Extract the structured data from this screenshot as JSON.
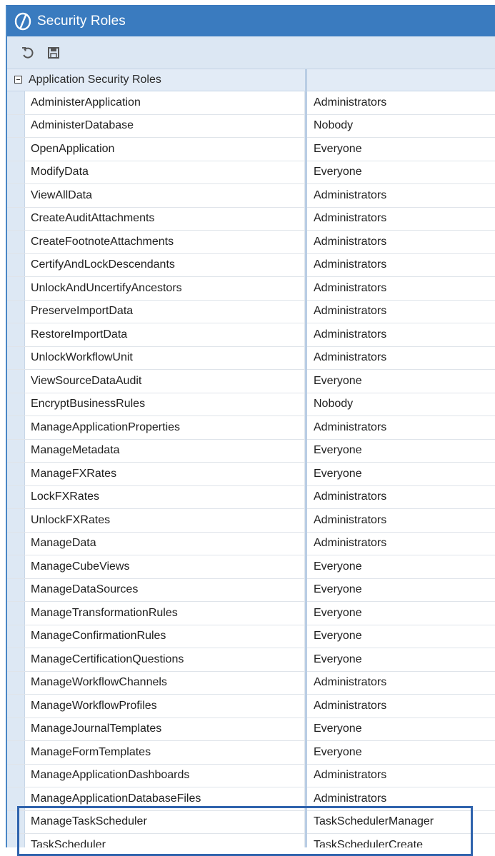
{
  "window": {
    "title": "Security Roles",
    "logo_icon": "onestream-logo-icon"
  },
  "toolbar": {
    "buttons": [
      {
        "icon": "refresh-icon",
        "tooltip": ""
      },
      {
        "icon": "save-icon",
        "tooltip": ""
      }
    ]
  },
  "group": {
    "label": "Application Security Roles",
    "expanded": true
  },
  "roles": [
    {
      "name": "AdministerApplication",
      "value": "Administrators"
    },
    {
      "name": "AdministerDatabase",
      "value": "Nobody"
    },
    {
      "name": "OpenApplication",
      "value": "Everyone"
    },
    {
      "name": "ModifyData",
      "value": "Everyone"
    },
    {
      "name": "ViewAllData",
      "value": "Administrators"
    },
    {
      "name": "CreateAuditAttachments",
      "value": "Administrators"
    },
    {
      "name": "CreateFootnoteAttachments",
      "value": "Administrators"
    },
    {
      "name": "CertifyAndLockDescendants",
      "value": "Administrators"
    },
    {
      "name": "UnlockAndUncertifyAncestors",
      "value": "Administrators"
    },
    {
      "name": "PreserveImportData",
      "value": "Administrators"
    },
    {
      "name": "RestoreImportData",
      "value": "Administrators"
    },
    {
      "name": "UnlockWorkflowUnit",
      "value": "Administrators"
    },
    {
      "name": "ViewSourceDataAudit",
      "value": "Everyone"
    },
    {
      "name": "EncryptBusinessRules",
      "value": "Nobody"
    },
    {
      "name": "ManageApplicationProperties",
      "value": "Administrators"
    },
    {
      "name": "ManageMetadata",
      "value": "Everyone"
    },
    {
      "name": "ManageFXRates",
      "value": "Everyone"
    },
    {
      "name": "LockFXRates",
      "value": "Administrators"
    },
    {
      "name": "UnlockFXRates",
      "value": "Administrators"
    },
    {
      "name": "ManageData",
      "value": "Administrators"
    },
    {
      "name": "ManageCubeViews",
      "value": "Everyone"
    },
    {
      "name": "ManageDataSources",
      "value": "Everyone"
    },
    {
      "name": "ManageTransformationRules",
      "value": "Everyone"
    },
    {
      "name": "ManageConfirmationRules",
      "value": "Everyone"
    },
    {
      "name": "ManageCertificationQuestions",
      "value": "Everyone"
    },
    {
      "name": "ManageWorkflowChannels",
      "value": "Administrators"
    },
    {
      "name": "ManageWorkflowProfiles",
      "value": "Administrators"
    },
    {
      "name": "ManageJournalTemplates",
      "value": "Everyone"
    },
    {
      "name": "ManageFormTemplates",
      "value": "Everyone"
    },
    {
      "name": "ManageApplicationDashboards",
      "value": "Administrators"
    },
    {
      "name": "ManageApplicationDatabaseFiles",
      "value": "Administrators"
    },
    {
      "name": "ManageTaskScheduler",
      "value": "TaskSchedulerManager"
    },
    {
      "name": "TaskScheduler",
      "value": "TaskSchedulerCreate"
    }
  ],
  "colors": {
    "title_bar": "#3a7bbf",
    "toolbar": "#dce7f3",
    "highlight_border": "#2f63ad"
  }
}
